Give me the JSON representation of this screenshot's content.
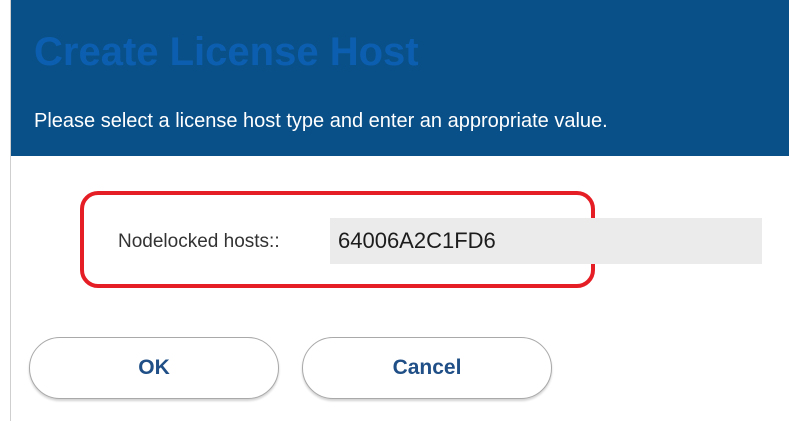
{
  "dialog": {
    "title": "Create License Host",
    "subtitle": "Please select a license host type and enter an appropriate value."
  },
  "host_field": {
    "label": "Nodelocked hosts::",
    "value": "64006A2C1FD6"
  },
  "buttons": {
    "ok_label": "OK",
    "cancel_label": "Cancel"
  },
  "colors": {
    "header_bg": "#0a5088",
    "title_text": "#0c5fb0",
    "highlight": "#e51e26",
    "button_text": "#1f4f86"
  }
}
